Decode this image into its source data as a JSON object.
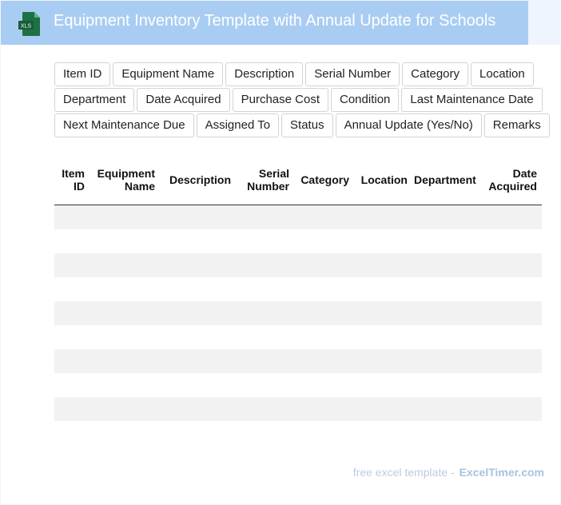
{
  "header": {
    "title": "Equipment Inventory Template with Annual Update for Schools",
    "file_icon": {
      "name": "xls-file-icon",
      "label": "XLS",
      "color": "#1e7145"
    }
  },
  "fields": [
    "Item ID",
    "Equipment Name",
    "Description",
    "Serial Number",
    "Category",
    "Location",
    "Department",
    "Date Acquired",
    "Purchase Cost",
    "Condition",
    "Last Maintenance Date",
    "Next Maintenance Due",
    "Assigned To",
    "Status",
    "Annual Update (Yes/No)",
    "Remarks"
  ],
  "table": {
    "columns": [
      "Item ID",
      "Equipment Name",
      "Description",
      "Serial Number",
      "Category",
      "Location",
      "Department",
      "Date Acquired"
    ],
    "rows": [
      [
        "",
        "",
        "",
        "",
        "",
        "",
        "",
        ""
      ],
      [
        "",
        "",
        "",
        "",
        "",
        "",
        "",
        ""
      ],
      [
        "",
        "",
        "",
        "",
        "",
        "",
        "",
        ""
      ],
      [
        "",
        "",
        "",
        "",
        "",
        "",
        "",
        ""
      ],
      [
        "",
        "",
        "",
        "",
        "",
        "",
        "",
        ""
      ],
      [
        "",
        "",
        "",
        "",
        "",
        "",
        "",
        ""
      ],
      [
        "",
        "",
        "",
        "",
        "",
        "",
        "",
        ""
      ],
      [
        "",
        "",
        "",
        "",
        "",
        "",
        "",
        ""
      ],
      [
        "",
        "",
        "",
        "",
        "",
        "",
        "",
        ""
      ],
      [
        "",
        "",
        "",
        "",
        "",
        "",
        "",
        ""
      ]
    ]
  },
  "footer": {
    "text": "free excel template -",
    "brand": "ExcelTimer.com"
  },
  "colors": {
    "header_bg": "#a9cdf2",
    "page_bg": "#eef5fd",
    "stripe": "#f2f2f2",
    "footer_text": "#b8cde2"
  }
}
